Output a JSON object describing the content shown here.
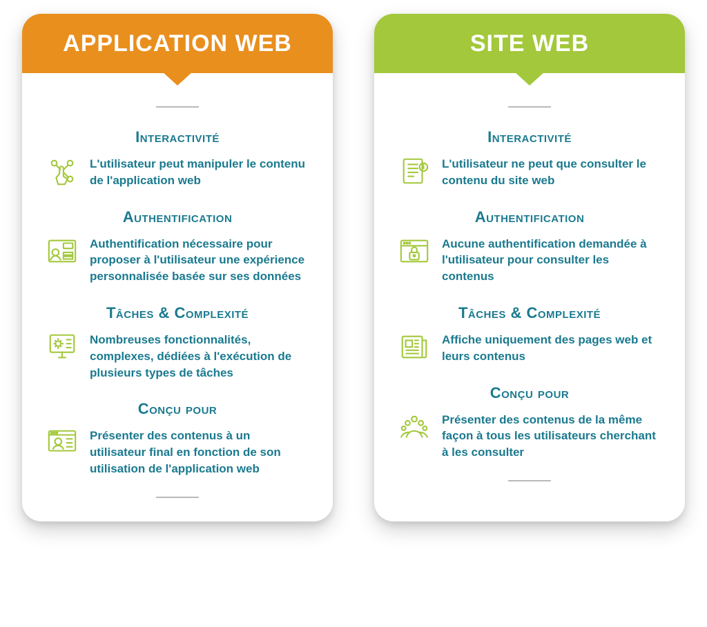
{
  "left": {
    "title": "APPLICATION WEB",
    "sections": [
      {
        "heading": "Interactivité",
        "text": "L'utilisateur peut manipuler le contenu de l'application web",
        "icon": "touch-icon"
      },
      {
        "heading": "Authentification",
        "text": "Authentification nécessaire pour proposer à l'utilisateur une expérience personnalisée basée sur ses données",
        "icon": "login-icon"
      },
      {
        "heading": "Tâches & Complexité",
        "text": "Nombreuses fonctionnalités, complexes, dédiées à l'exécution de plusieurs types de tâches",
        "icon": "settings-monitor-icon"
      },
      {
        "heading": "Conçu pour",
        "text": "Présenter des contenus à un utilisateur final en fonction de son utilisation de l'application web",
        "icon": "user-screen-icon"
      }
    ]
  },
  "right": {
    "title": "SITE WEB",
    "sections": [
      {
        "heading": "Interactivité",
        "text": "L'utilisateur ne peut que consulter le contenu du site web",
        "icon": "document-icon"
      },
      {
        "heading": "Authentification",
        "text": "Aucune authentification demandée à l'utilisateur pour consulter les contenus",
        "icon": "lock-browser-icon"
      },
      {
        "heading": "Tâches & Complexité",
        "text": "Affiche uniquement des pages web et leurs contenus",
        "icon": "news-icon"
      },
      {
        "heading": "Conçu pour",
        "text": "Présenter des contenus de la même façon à tous les utilisateurs cherchant à les consulter",
        "icon": "crowd-icon"
      }
    ]
  }
}
